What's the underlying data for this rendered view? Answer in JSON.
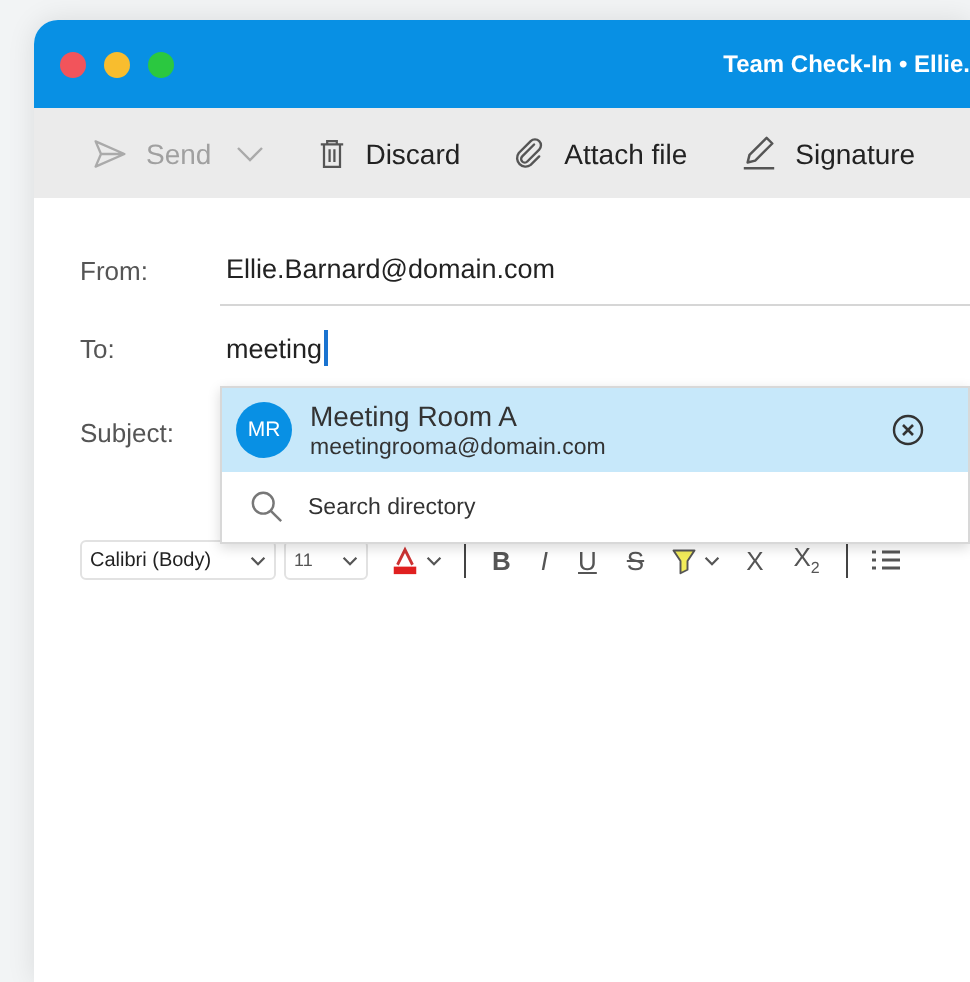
{
  "window": {
    "title": "Team Check-In • Ellie."
  },
  "toolbar": [
    {
      "label": "Send",
      "disabled": true,
      "has_menu": true
    },
    {
      "label": "Discard",
      "disabled": false,
      "has_menu": false
    },
    {
      "label": "Attach file",
      "disabled": false,
      "has_menu": false
    },
    {
      "label": "Signature",
      "disabled": false,
      "has_menu": false
    }
  ],
  "fields": [
    {
      "label": "From:",
      "value": "Ellie.Barnard@domain.com",
      "focused": false
    },
    {
      "label": "To:",
      "value": "meeting",
      "focused": true
    },
    {
      "label": "Subject:"
    }
  ],
  "suggestions": {
    "items": [
      {
        "initials": "MR",
        "name": "Meeting Room A",
        "email": "meetingrooma@domain.com",
        "selected": true
      }
    ],
    "search": "Search directory"
  },
  "format_toolbar": {
    "font": "Calibri (Body)",
    "size": "11",
    "buttons": [
      {
        "kind": "bold",
        "label": "B"
      },
      {
        "kind": "italic",
        "label": "I"
      },
      {
        "kind": "underline",
        "label": "U"
      },
      {
        "kind": "strikethrough",
        "label": "S"
      },
      {
        "kind": "highlight"
      },
      {
        "kind": "plain",
        "label": "X"
      },
      {
        "kind": "subscript",
        "label": "X$_{2}$"
      },
      {
        "kind": "divider"
      },
      {
        "kind": "list"
      }
    ]
  }
}
